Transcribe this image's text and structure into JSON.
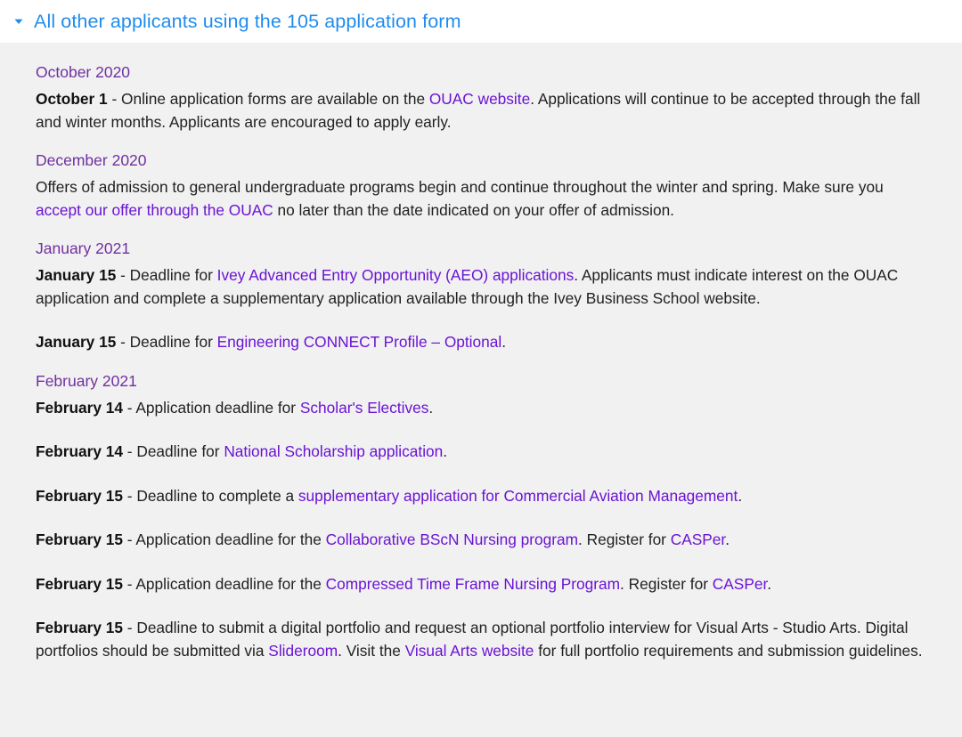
{
  "accordion": {
    "title": "All other applicants using the 105 application form",
    "expanded": true,
    "toggle_icon": "caret-down-icon",
    "title_color": "#1f8ced"
  },
  "colors": {
    "header_text": "#1f8ced",
    "month_heading": "#7030a0",
    "link": "#6a13d4",
    "body_text": "#212121",
    "panel_background": "#f1f1f1",
    "header_background": "#ffffff"
  },
  "sections": [
    {
      "heading": "October 2020",
      "entries": [
        {
          "date": "October 1",
          "parts": [
            {
              "type": "text",
              "value": " - Online application forms are available on the "
            },
            {
              "type": "link",
              "value": "OUAC website"
            },
            {
              "type": "text",
              "value": ".  Applications will continue to be accepted through the fall and winter months.  Applicants are encouraged to apply early."
            }
          ]
        }
      ]
    },
    {
      "heading": "December 2020",
      "entries": [
        {
          "date": "",
          "parts": [
            {
              "type": "text",
              "value": "Offers of admission to general undergraduate programs begin and continue throughout the winter and spring. Make sure you "
            },
            {
              "type": "link",
              "value": "accept our offer through the OUAC"
            },
            {
              "type": "text",
              "value": " no later than the date indicated on your offer of admission."
            }
          ]
        }
      ]
    },
    {
      "heading": "January 2021",
      "entries": [
        {
          "date": "January 15",
          "parts": [
            {
              "type": "text",
              "value": " - Deadline for "
            },
            {
              "type": "link",
              "value": "Ivey Advanced Entry Opportunity (AEO) applications"
            },
            {
              "type": "text",
              "value": ".  Applicants must indicate interest on the OUAC application and complete a supplementary application available through the Ivey Business School website."
            }
          ]
        },
        {
          "date": "January 15",
          "parts": [
            {
              "type": "text",
              "value": " - Deadline for "
            },
            {
              "type": "link",
              "value": "Engineering CONNECT Profile – Optional"
            },
            {
              "type": "text",
              "value": "."
            }
          ]
        }
      ]
    },
    {
      "heading": "February 2021",
      "entries": [
        {
          "date": "February 14",
          "parts": [
            {
              "type": "text",
              "value": " - Application deadline for "
            },
            {
              "type": "link",
              "value": "Scholar's Electives"
            },
            {
              "type": "text",
              "value": "."
            }
          ]
        },
        {
          "date": "February 14",
          "parts": [
            {
              "type": "text",
              "value": " - Deadline for "
            },
            {
              "type": "link",
              "value": "National Scholarship application"
            },
            {
              "type": "text",
              "value": "."
            }
          ]
        },
        {
          "date": "February 15",
          "parts": [
            {
              "type": "text",
              "value": " - Deadline to complete a "
            },
            {
              "type": "link",
              "value": "supplementary application for Commercial Aviation Management"
            },
            {
              "type": "text",
              "value": "."
            }
          ]
        },
        {
          "date": "February 15",
          "parts": [
            {
              "type": "text",
              "value": " - Application deadline for the "
            },
            {
              "type": "link",
              "value": "Collaborative BScN Nursing program"
            },
            {
              "type": "text",
              "value": ". Register for "
            },
            {
              "type": "link",
              "value": "CASPer"
            },
            {
              "type": "text",
              "value": "."
            }
          ]
        },
        {
          "date": "February 15",
          "parts": [
            {
              "type": "text",
              "value": " - Application deadline for the "
            },
            {
              "type": "link",
              "value": "Compressed Time Frame Nursing Program"
            },
            {
              "type": "text",
              "value": ". Register for "
            },
            {
              "type": "link",
              "value": "CASPer"
            },
            {
              "type": "text",
              "value": "."
            }
          ]
        },
        {
          "date": "February 15",
          "parts": [
            {
              "type": "text",
              "value": " - Deadline to submit a digital portfolio and request an optional portfolio interview for Visual Arts - Studio Arts. Digital portfolios should be submitted via "
            },
            {
              "type": "link",
              "value": "Slideroom"
            },
            {
              "type": "text",
              "value": ".  Visit the "
            },
            {
              "type": "link",
              "value": "Visual Arts website"
            },
            {
              "type": "text",
              "value": " for full portfolio requirements and submission guidelines."
            }
          ]
        }
      ]
    }
  ]
}
